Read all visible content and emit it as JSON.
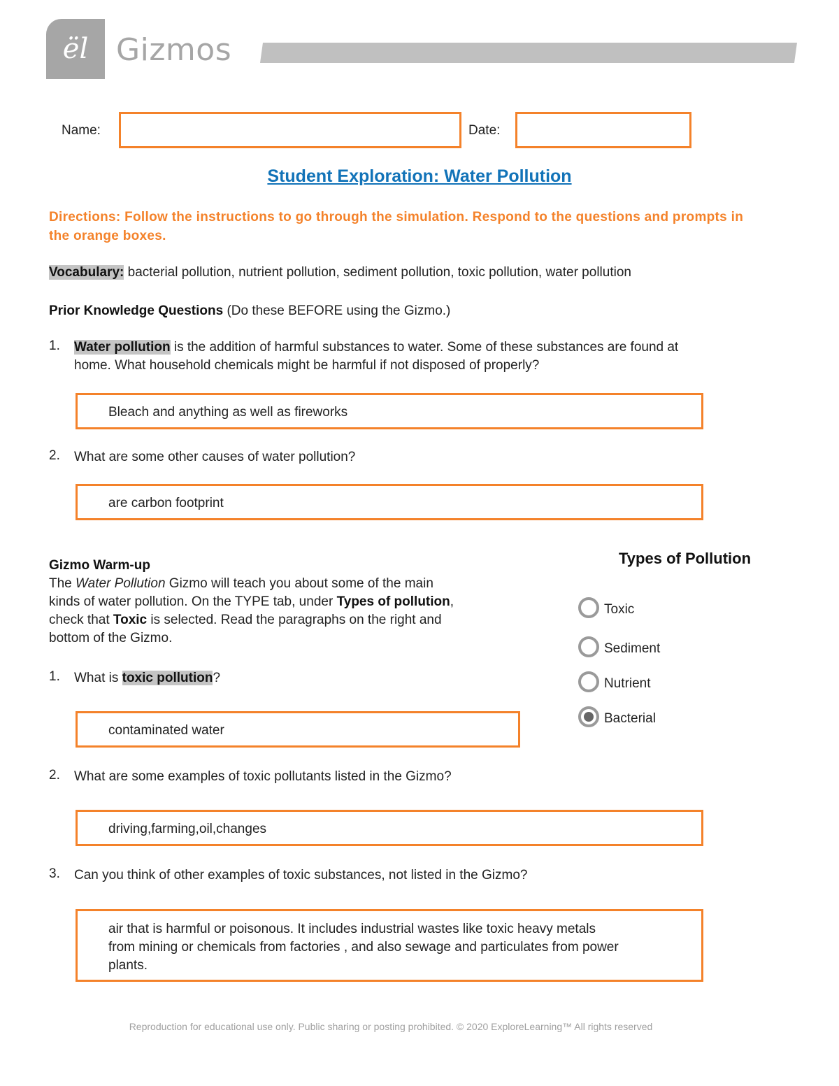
{
  "header": {
    "logo_glyph": "ël",
    "brand": "Gizmos"
  },
  "form": {
    "name_label": "Name:",
    "name_value": "",
    "date_label": "Date:",
    "date_value": ""
  },
  "title": "Student Exploration: Water Pollution",
  "directions": "Directions: Follow the instructions to go through the simulation. Respond to the questions and prompts in the orange boxes.",
  "vocabulary": {
    "label": "Vocabulary:",
    "terms": "bacterial pollution, nutrient pollution, sediment pollution, toxic pollution, water pollution"
  },
  "prior_knowledge": {
    "heading": "Prior Knowledge Questions",
    "note": "(Do these BEFORE using the Gizmo.)",
    "questions": [
      {
        "number": "1.",
        "highlight": "Water pollution",
        "text_line1": " is the addition of harmful substances to water. Some of these substances are found at",
        "text_line2": "home. What household chemicals might be harmful if not disposed of properly?",
        "answer": "Bleach and anything as well as fireworks"
      },
      {
        "number": "2.",
        "text": "What are some other causes of water pollution?",
        "answer": "are carbon footprint"
      }
    ]
  },
  "warmup": {
    "heading": "Gizmo Warm-up",
    "intro_1": "The ",
    "intro_italic": "Water Pollution",
    "intro_2": " Gizmo will teach you about some of the main",
    "intro_3": "kinds of water pollution. On the TYPE tab, under ",
    "intro_bold1": "Types of pollution",
    "intro_4": ",",
    "intro_5": "check that ",
    "intro_bold2": "Toxic",
    "intro_6": " is selected. Read the paragraphs on the right and",
    "intro_7": "bottom of the Gizmo.",
    "questions": [
      {
        "number": "1.",
        "text_before": "What is ",
        "highlight": "toxic pollution",
        "text_after": "?",
        "answer": "contaminated water"
      },
      {
        "number": "2.",
        "text": "What are some examples of toxic pollutants listed in the Gizmo?",
        "answer": "driving,farming,oil,changes"
      },
      {
        "number": "3.",
        "text": "Can you think of other examples of toxic substances, not listed in the Gizmo?",
        "answer_lines": [
          "air that is harmful or poisonous. It includes industrial wastes like toxic heavy metals",
          "from mining or chemicals from factories , and also sewage and particulates from power",
          "plants."
        ]
      }
    ]
  },
  "types_panel": {
    "title": "Types of Pollution",
    "options": [
      {
        "label": "Toxic",
        "selected": false
      },
      {
        "label": "Sediment",
        "selected": false
      },
      {
        "label": "Nutrient",
        "selected": false
      },
      {
        "label": "Bacterial",
        "selected": true
      }
    ]
  },
  "footer": "Reproduction for educational use only. Public sharing or posting prohibited. © 2020 ExploreLearning™ All rights reserved"
}
